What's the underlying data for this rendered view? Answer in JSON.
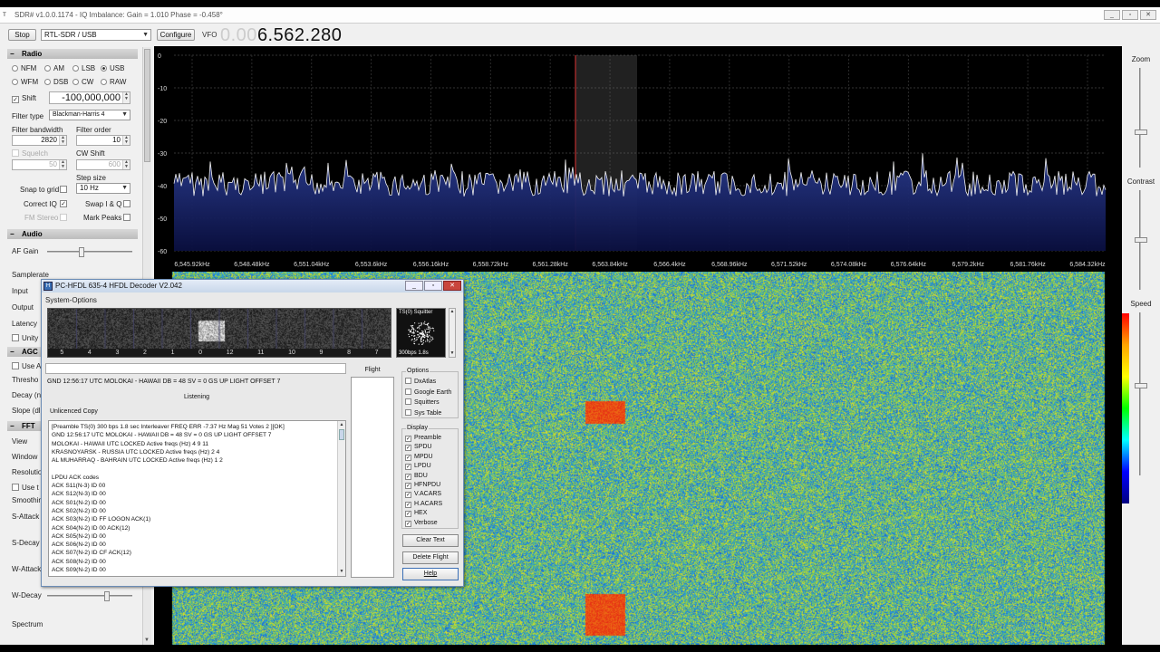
{
  "window": {
    "title": "SDR# v1.0.0.1174 - IQ Imbalance: Gain = 1.010 Phase = -0.458°",
    "min": "_",
    "max": "▫",
    "close": "✕"
  },
  "toolbar": {
    "stop_label": "Stop",
    "device": "RTL-SDR / USB",
    "configure_label": "Configure",
    "vfo_label": "VFO",
    "vfo_dim": "0.00",
    "vfo_value": "6.562.280"
  },
  "radio": {
    "header": "Radio",
    "modes": [
      "NFM",
      "AM",
      "LSB",
      "USB",
      "WFM",
      "DSB",
      "CW",
      "RAW"
    ],
    "selected_mode": "USB",
    "shift_label": "Shift",
    "shift_checked": true,
    "shift_value": "-100,000,000",
    "filter_type_label": "Filter type",
    "filter_type": "Blackman-Harris 4",
    "filter_bw_label": "Filter bandwidth",
    "filter_bw": "2820",
    "filter_order_label": "Filter order",
    "filter_order": "10",
    "squelch_label": "Squelch",
    "squelch_value": "50",
    "cw_shift_label": "CW Shift",
    "cw_shift_value": "600",
    "step_size_label": "Step size",
    "step_size": "10 Hz",
    "snap_label": "Snap to grid",
    "correct_iq_label": "Correct IQ",
    "swap_iq_label": "Swap I & Q",
    "fm_stereo_label": "FM Stereo",
    "mark_peaks_label": "Mark Peaks"
  },
  "audio": {
    "header": "Audio",
    "af_gain_label": "AF Gain",
    "af_gain_level": 0.4,
    "labels": [
      "Samplerate",
      "Input",
      "Output",
      "Latency",
      "Unity"
    ]
  },
  "agc": {
    "header": "AGC",
    "labels": [
      "Use A",
      "Thresho",
      "Decay (n",
      "Slope (dl"
    ]
  },
  "fft": {
    "header": "FFT",
    "labels": [
      "View",
      "Window",
      "Resolutio",
      "Use t",
      "Smoothin",
      "S-Attack",
      "S-Decay",
      "W-Attack",
      "W-Decay",
      "Spectrum"
    ],
    "w_decay_level": 0.72
  },
  "spectrum": {
    "db_ticks": [
      "0",
      "-10",
      "-20",
      "-30",
      "-40",
      "-50",
      "-60"
    ],
    "freq_ticks": [
      "6,545.92kHz",
      "6,548.48kHz",
      "6,551.04kHz",
      "6,553.6kHz",
      "6,556.16kHz",
      "6,558.72kHz",
      "6,561.28kHz",
      "6,563.84kHz",
      "6,566.4kHz",
      "6,568.96kHz",
      "6,571.52kHz",
      "6,574.08kHz",
      "6,576.64kHz",
      "6,579.2kHz",
      "6,581.76kHz",
      "6,584.32kHz"
    ]
  },
  "right": {
    "zoom": "Zoom",
    "contrast": "Contrast",
    "speed": "Speed",
    "zoom_level": 0.35,
    "contrast_level": 0.5,
    "speed_level": 0.45
  },
  "decoder": {
    "title": "PC-HFDL 635-4 HFDL Decoder V2.042",
    "menu": "System-Options",
    "strip_labels": [
      "5",
      "4",
      "3",
      "2",
      "1",
      "0",
      "12",
      "11",
      "10",
      "9",
      "8",
      "7"
    ],
    "squitter_title": "TS(0) Squitter",
    "squitter_rate": "300bps 1.8s",
    "status_line": "GND 12:56:17 UTC MOLOKAI - HAWAII DB = 48  SV = 0  GS UP LIGHT  OFFSET 7",
    "listening": "Listening",
    "unlicenced": "Unlicenced Copy",
    "log_lines": [
      "[Preamble TS(0) 300  bps 1.8 sec Interleaver FREQ ERR -7.37 Hz Mag 51 Votes 2 ][OK]",
      " GND 12:56:17 UTC MOLOKAI - HAWAII  DB = 48  SV = 0  GS UP LIGHT  OFFSET 7",
      "MOLOKAI - HAWAII UTC LOCKED Active freqs (Hz)       4      9      11",
      "KRASNOYARSK - RUSSIA UTC LOCKED Active freqs (Hz)       2      4",
      "AL MUHARRAQ - BAHRAIN UTC LOCKED Active freqs (Hz)       1      2",
      "",
      "LPDU ACK codes",
      "ACK S11(N-3) ID 00",
      "ACK S12(N-3) ID 00",
      "ACK S01(N-2) ID 00",
      "ACK S02(N-2) ID 00",
      "ACK S03(N-2) ID FF LOGON ACK(1)",
      "ACK S04(N-2) ID 00  ACK(12)",
      "ACK S05(N-2) ID 00",
      "ACK S06(N-2) ID 00",
      "ACK S07(N-2) ID CF  ACK(12)",
      "ACK S08(N-2) ID 00",
      "ACK S09(N-2) ID 00"
    ],
    "flight_label": "Flight",
    "options_title": "Options",
    "options": [
      {
        "label": "DxAtlas",
        "checked": false
      },
      {
        "label": "Google Earth",
        "checked": false
      },
      {
        "label": "Squitters",
        "checked": false
      },
      {
        "label": "Sys Table",
        "checked": false
      }
    ],
    "display_title": "Display",
    "display": [
      {
        "label": "Preamble",
        "checked": true
      },
      {
        "label": "SPDU",
        "checked": true
      },
      {
        "label": "MPDU",
        "checked": true
      },
      {
        "label": "LPDU",
        "checked": true
      },
      {
        "label": "BDU",
        "checked": true
      },
      {
        "label": "HFNPDU",
        "checked": true
      },
      {
        "label": "V.ACARS",
        "checked": true
      },
      {
        "label": "H.ACARS",
        "checked": true
      },
      {
        "label": "HEX",
        "checked": true
      },
      {
        "label": "Verbose",
        "checked": true
      }
    ],
    "clear_text": "Clear Text",
    "delete_flight": "Delete Flight",
    "help": "Help"
  }
}
